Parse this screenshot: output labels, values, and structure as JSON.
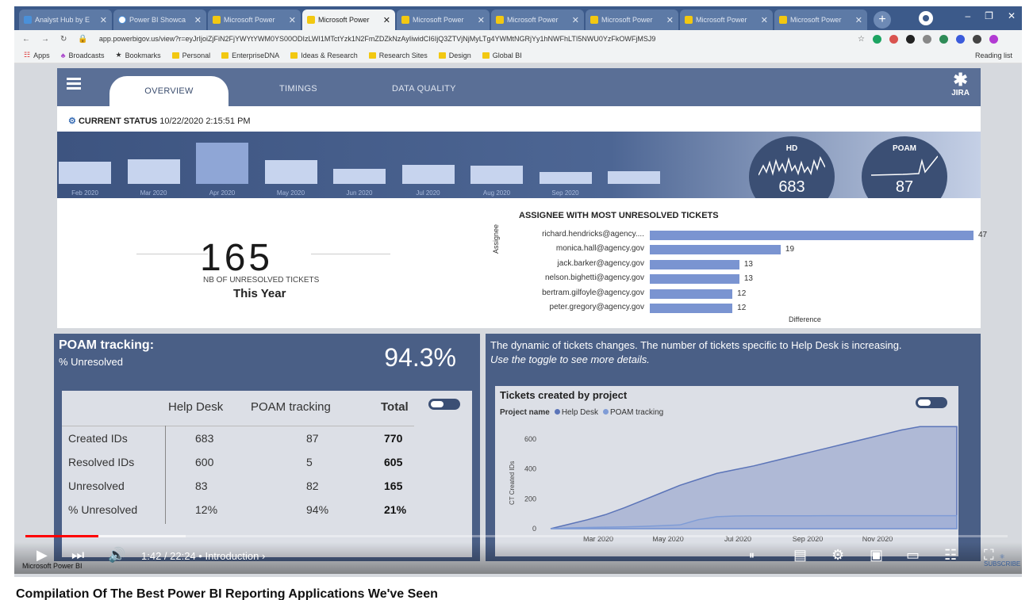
{
  "browser": {
    "tabs": [
      {
        "label": "Analyst Hub by E",
        "icon": "blue"
      },
      {
        "label": "Power BI Showca",
        "icon": "white"
      },
      {
        "label": "Microsoft Power",
        "icon": "yellow"
      },
      {
        "label": "Microsoft Power",
        "icon": "yellow",
        "active": true
      },
      {
        "label": "Microsoft Power",
        "icon": "yellow"
      },
      {
        "label": "Microsoft Power",
        "icon": "yellow"
      },
      {
        "label": "Microsoft Power",
        "icon": "yellow"
      },
      {
        "label": "Microsoft Power",
        "icon": "yellow"
      },
      {
        "label": "Microsoft Power",
        "icon": "yellow"
      }
    ],
    "url": "app.powerbigov.us/view?r=eyJrIjoiZjFiN2FjYWYtYWM0YS00ODIzLWI1MTctYzk1N2FmZDZkNzAyIiwidCI6IjQ3ZTVjNjMyLTg4YWMtNGRjYy1hNWFhLTI5NWU0YzFkOWFjMSJ9",
    "bookmarks": [
      "Apps",
      "Broadcasts",
      "Bookmarks",
      "Personal",
      "EnterpriseDNA",
      "Ideas & Research",
      "Research Sites",
      "Design",
      "Global BI"
    ],
    "reading_list": "Reading list"
  },
  "report": {
    "nav": {
      "tabs": [
        "OVERVIEW",
        "TIMINGS",
        "DATA QUALITY"
      ],
      "logo_text": "JIRA"
    },
    "status": {
      "label": "CURRENT STATUS",
      "datetime": "10/22/2020 2:15:51 PM"
    },
    "monthly_bars": {
      "labels": [
        "Feb 2020",
        "Mar 2020",
        "Apr 2020",
        "May 2020",
        "Jun 2020",
        "Jul 2020",
        "Aug 2020",
        "Sep 2020",
        ""
      ],
      "values": [
        28,
        31,
        52,
        30,
        19,
        24,
        23,
        15,
        16
      ]
    },
    "gauges": [
      {
        "label": "HD",
        "value": "683"
      },
      {
        "label": "POAM",
        "value": "87"
      }
    ],
    "unresolved": {
      "value": "165",
      "label": "NB OF UNRESOLVED TICKETS",
      "period": "This Year"
    },
    "assignee_chart": {
      "title": "ASSIGNEE WITH MOST UNRESOLVED TICKETS",
      "ylabel": "Assignee",
      "xlabel": "Difference",
      "rows": [
        {
          "name": "richard.hendricks@agency....",
          "value": 47
        },
        {
          "name": "monica.hall@agency.gov",
          "value": 19
        },
        {
          "name": "jack.barker@agency.gov",
          "value": 13
        },
        {
          "name": "nelson.bighetti@agency.gov",
          "value": 13
        },
        {
          "name": "bertram.gilfoyle@agency.gov",
          "value": 12
        },
        {
          "name": "peter.gregory@agency.gov",
          "value": 12
        }
      ]
    },
    "poam": {
      "title": "POAM tracking:",
      "subtitle": "% Unresolved",
      "percent": "94.3%",
      "table": {
        "headers": [
          "Help Desk",
          "POAM tracking",
          "Total"
        ],
        "rows": [
          {
            "label": "Created IDs",
            "hd": "683",
            "poam": "87",
            "total": "770"
          },
          {
            "label": "Resolved IDs",
            "hd": "600",
            "poam": "5",
            "total": "605"
          },
          {
            "label": "Unresolved",
            "hd": "83",
            "poam": "82",
            "total": "165"
          },
          {
            "label": "% Unresolved",
            "hd": "12%",
            "poam": "94%",
            "total": "21%"
          }
        ]
      }
    },
    "dynamic": {
      "line1": "The dynamic of tickets changes. The number of tickets specific to Help Desk is increasing.",
      "line2": "Use the toggle to see more details."
    }
  },
  "chart_data": {
    "type": "area",
    "title": "Tickets created by project",
    "legend_title": "Project name",
    "ylabel": "CT Created IDs",
    "ylim": [
      0,
      700
    ],
    "yticks": [
      0,
      200,
      400,
      600
    ],
    "xticks": [
      "Mar 2020",
      "May 2020",
      "Jul 2020",
      "Sep 2020",
      "Nov 2020"
    ],
    "series": [
      {
        "name": "Help Desk",
        "color": "#5b74b8",
        "values": [
          0,
          30,
          60,
          95,
          140,
          190,
          240,
          290,
          330,
          370,
          395,
          420,
          450,
          480,
          510,
          540,
          570,
          600,
          630,
          660,
          683,
          683,
          683
        ]
      },
      {
        "name": "POAM tracking",
        "color": "#7f9cd6",
        "values": [
          0,
          5,
          8,
          10,
          12,
          15,
          20,
          25,
          60,
          80,
          85,
          86,
          86,
          86,
          86,
          87,
          87,
          87,
          87,
          87,
          87,
          87,
          87
        ]
      }
    ]
  },
  "video": {
    "time": "1:42 / 22:24",
    "chapter": "Introduction",
    "channel_watermark": "Microsoft Power BI",
    "title": "Compilation Of The Best Power BI Reporting Applications We've Seen"
  }
}
